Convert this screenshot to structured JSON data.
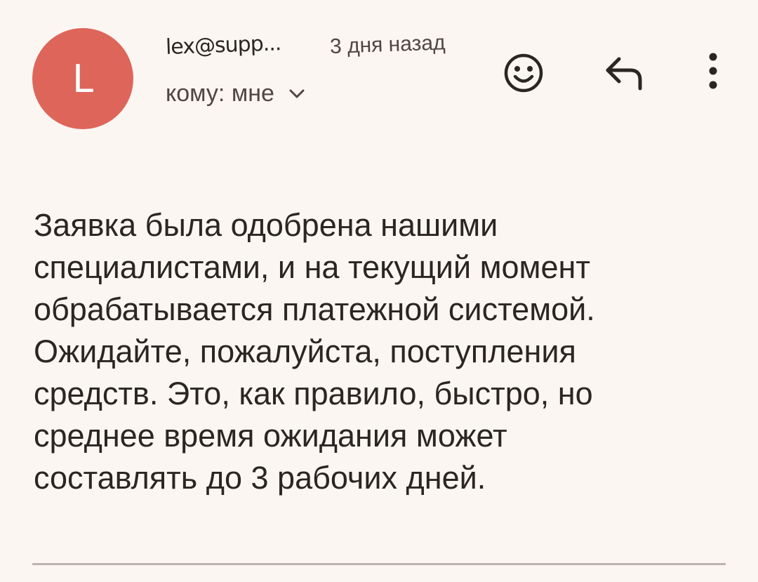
{
  "header": {
    "avatar_letter": "L",
    "sender": "lex@supp...",
    "time": "3 дня назад",
    "recipient": "кому: мне",
    "icons": {
      "emoji": "smiley-face-icon",
      "reply": "reply-arrow-icon",
      "more": "more-vert-icon",
      "expand": "chevron-down-icon"
    }
  },
  "message": {
    "body": "Заявка была одобрена нашими\nспециалистами, и на текущий момент\nобрабатывается платежной системой.\nОжидайте, пожалуйста, поступления\nсредств. Это, как правило, быстро, но\nсреднее время ожидания может\nсоставлять до 3 рабочих дней."
  },
  "colors": {
    "background": "#fcf6f3",
    "avatar": "#de6559",
    "text": "#2b2523",
    "secondary_text": "#4e4644"
  }
}
